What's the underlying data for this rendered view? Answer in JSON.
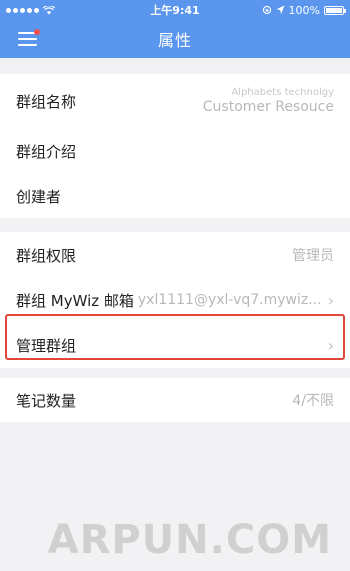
{
  "status_bar": {
    "time": "上午9:41",
    "battery": "100%"
  },
  "nav": {
    "title": "属性"
  },
  "section1": {
    "rows": [
      {
        "label": "群组名称",
        "value_small": "Alphabets technolgy",
        "value_big": "Customer Resouce"
      },
      {
        "label": "群组介绍"
      },
      {
        "label": "创建者"
      }
    ]
  },
  "section2": {
    "rows": [
      {
        "label": "群组权限",
        "value": "管理员"
      },
      {
        "label": "群组 MyWiz 邮箱",
        "value": "yxl1111@yxl-vq7.mywiz..."
      },
      {
        "label": "管理群组"
      }
    ]
  },
  "section3": {
    "rows": [
      {
        "label": "笔记数量",
        "value": "4/不限"
      }
    ]
  },
  "watermark": "ARPUN.COM",
  "colors": {
    "accent": "#5a96ee",
    "highlight": "#e0463a"
  }
}
